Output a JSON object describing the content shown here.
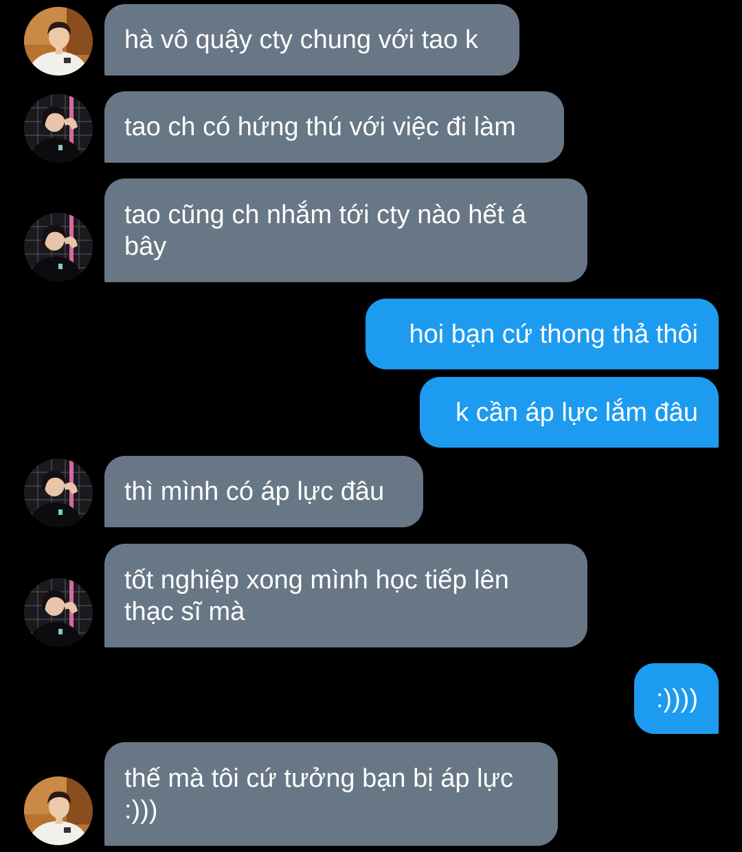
{
  "colors": {
    "background": "#000000",
    "incoming_bubble": "#687785",
    "outgoing_bubble": "#1d9bf0",
    "text": "#ffffff"
  },
  "messages": [
    {
      "side": "incoming",
      "avatar": "user-avatar-a",
      "lines": [
        "hà vô quậy cty chung với tao k"
      ]
    },
    {
      "side": "incoming",
      "avatar": "user-avatar-b",
      "lines": [
        "tao ch có hứng thú với việc đi làm"
      ]
    },
    {
      "side": "incoming",
      "avatar": "user-avatar-b",
      "lines": [
        "tao cũng ch nhắm tới cty nào hết á",
        "bây"
      ]
    },
    {
      "side": "outgoing",
      "lines": [
        "hoi bạn cứ thong thả thôi"
      ]
    },
    {
      "side": "outgoing",
      "lines": [
        "k cần áp lực lắm đâu"
      ]
    },
    {
      "side": "incoming",
      "avatar": "user-avatar-b",
      "lines": [
        "thì mình có áp lực đâu"
      ]
    },
    {
      "side": "incoming",
      "avatar": "user-avatar-b",
      "lines": [
        "tốt nghiệp xong mình học tiếp lên",
        "thạc sĩ mà"
      ]
    },
    {
      "side": "outgoing",
      "lines": [
        ":))))"
      ]
    },
    {
      "side": "incoming",
      "avatar": "user-avatar-a",
      "lines": [
        "thế mà tôi cứ tưởng bạn bị áp lực",
        ":)))"
      ]
    }
  ]
}
